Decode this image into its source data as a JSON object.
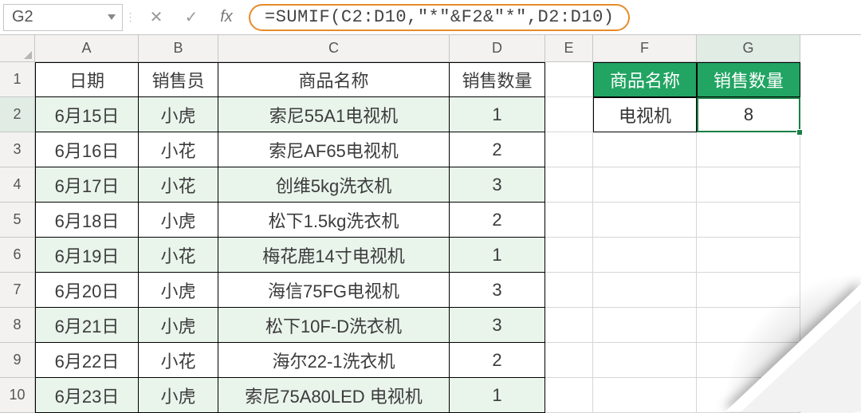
{
  "formula_bar": {
    "name_box": "G2",
    "fx_label": "fx",
    "formula": "=SUMIF(C2:D10,\"*\"&F2&\"*\",D2:D10)"
  },
  "columns": [
    "A",
    "B",
    "C",
    "D",
    "E",
    "F",
    "G"
  ],
  "row_numbers": [
    "1",
    "2",
    "3",
    "4",
    "5",
    "6",
    "7",
    "8",
    "9",
    "10"
  ],
  "table": {
    "headers": {
      "A": "日期",
      "B": "销售员",
      "C": "商品名称",
      "D": "销售数量"
    },
    "rows": [
      {
        "A": "6月15日",
        "B": "小虎",
        "C": "索尼55A1电视机",
        "D": "1"
      },
      {
        "A": "6月16日",
        "B": "小花",
        "C": "索尼AF65电视机",
        "D": "2"
      },
      {
        "A": "6月17日",
        "B": "小花",
        "C": "创维5kg洗衣机",
        "D": "3"
      },
      {
        "A": "6月18日",
        "B": "小虎",
        "C": "松下1.5kg洗衣机",
        "D": "2"
      },
      {
        "A": "6月19日",
        "B": "小花",
        "C": "梅花鹿14寸电视机",
        "D": "1"
      },
      {
        "A": "6月20日",
        "B": "小虎",
        "C": "海信75FG电视机",
        "D": "3"
      },
      {
        "A": "6月21日",
        "B": "小虎",
        "C": "松下10F-D洗衣机",
        "D": "3"
      },
      {
        "A": "6月22日",
        "B": "小花",
        "C": "海尔22-1洗衣机",
        "D": "2"
      },
      {
        "A": "6月23日",
        "B": "小虎",
        "C": "索尼75A80LED 电视机",
        "D": "1"
      }
    ]
  },
  "summary": {
    "headers": {
      "F": "商品名称",
      "G": "销售数量"
    },
    "row": {
      "F": "电视机",
      "G": "8"
    }
  },
  "active_cell": "G2"
}
